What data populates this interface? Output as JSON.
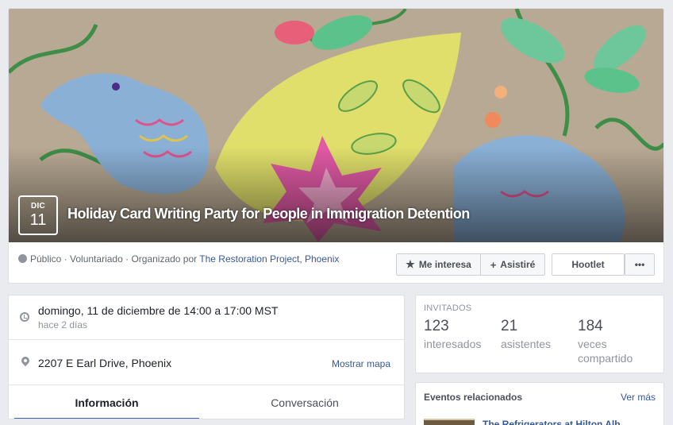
{
  "event": {
    "month": "DIC",
    "day": "11",
    "title": "Holiday Card Writing Party for People in Immigration Detention",
    "privacy": "Público",
    "category": "Voluntariado",
    "organized_by_prefix": "Organizado por",
    "organizer": "The Restoration Project, Phoenix"
  },
  "actions": {
    "interested": "Me interesa",
    "attend": "Asistiré",
    "hootlet": "Hootlet",
    "more": "•••"
  },
  "details": {
    "date_time": "domingo, 11 de diciembre de 14:00 a 17:00 MST",
    "relative": "hace 2 días",
    "address": "2207 E Earl Drive, Phoenix",
    "map_link": "Mostrar mapa"
  },
  "tabs": [
    {
      "label": "Información",
      "active": true
    },
    {
      "label": "Conversación",
      "active": false
    }
  ],
  "guests": {
    "title": "INVITADOS",
    "stats": [
      {
        "value": "123",
        "label": "interesados"
      },
      {
        "value": "21",
        "label": "asistentes"
      },
      {
        "value": "184",
        "label": "veces compartido"
      }
    ]
  },
  "related": {
    "title": "Eventos relacionados",
    "see_more": "Ver más",
    "first_event": "The Refrigerators at Hilton Alb..."
  },
  "colors": {
    "link": "#365899",
    "tab_active": "#4267b2"
  }
}
